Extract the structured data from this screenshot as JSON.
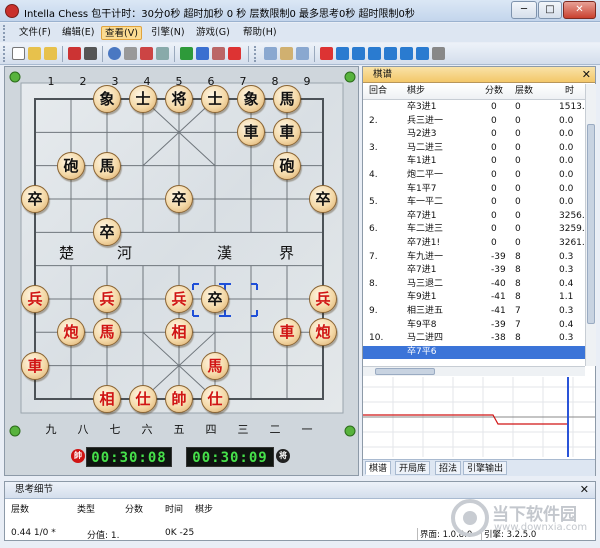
{
  "window": {
    "title": "Intella Chess 包干计时：30分0秒 超时加秒 0 秒 层数限制0 最多思考0秒 超时限制0秒",
    "min": "─",
    "max": "□",
    "close": "✕"
  },
  "menu": {
    "items": [
      "文件(F)",
      "编辑(E)",
      "查看(V)",
      "引擎(N)",
      "游戏(G)",
      "帮助(H)"
    ],
    "active": "查看(V)"
  },
  "board": {
    "top_numbers": [
      "1",
      "2",
      "3",
      "4",
      "5",
      "6",
      "7",
      "8",
      "9"
    ],
    "bottom_numbers": [
      "九",
      "八",
      "七",
      "六",
      "五",
      "四",
      "三",
      "二",
      "一"
    ],
    "river": [
      "楚",
      "河",
      "漢",
      "界"
    ],
    "pieces": [
      {
        "t": "象",
        "c": "black",
        "f": 2,
        "r": 0
      },
      {
        "t": "士",
        "c": "black",
        "f": 3,
        "r": 0
      },
      {
        "t": "将",
        "c": "black",
        "f": 4,
        "r": 0
      },
      {
        "t": "士",
        "c": "black",
        "f": 5,
        "r": 0
      },
      {
        "t": "象",
        "c": "black",
        "f": 6,
        "r": 0
      },
      {
        "t": "馬",
        "c": "black",
        "f": 7,
        "r": 0
      },
      {
        "t": "車",
        "c": "black",
        "f": 6,
        "r": 1
      },
      {
        "t": "車",
        "c": "black",
        "f": 7,
        "r": 1
      },
      {
        "t": "砲",
        "c": "black",
        "f": 1,
        "r": 2
      },
      {
        "t": "馬",
        "c": "black",
        "f": 2,
        "r": 2
      },
      {
        "t": "砲",
        "c": "black",
        "f": 7,
        "r": 2
      },
      {
        "t": "卒",
        "c": "black",
        "f": 0,
        "r": 3
      },
      {
        "t": "卒",
        "c": "black",
        "f": 4,
        "r": 3
      },
      {
        "t": "卒",
        "c": "black",
        "f": 8,
        "r": 3
      },
      {
        "t": "卒",
        "c": "black",
        "f": 2,
        "r": 4
      },
      {
        "t": "兵",
        "c": "red",
        "f": 0,
        "r": 6
      },
      {
        "t": "兵",
        "c": "red",
        "f": 2,
        "r": 6
      },
      {
        "t": "兵",
        "c": "red",
        "f": 4,
        "r": 6
      },
      {
        "t": "卒",
        "c": "black",
        "f": 5,
        "r": 6
      },
      {
        "t": "兵",
        "c": "red",
        "f": 8,
        "r": 6
      },
      {
        "t": "炮",
        "c": "red",
        "f": 1,
        "r": 7
      },
      {
        "t": "馬",
        "c": "red",
        "f": 2,
        "r": 7
      },
      {
        "t": "相",
        "c": "red",
        "f": 4,
        "r": 7
      },
      {
        "t": "車",
        "c": "red",
        "f": 7,
        "r": 7
      },
      {
        "t": "炮",
        "c": "red",
        "f": 8,
        "r": 7
      },
      {
        "t": "車",
        "c": "red",
        "f": 0,
        "r": 8
      },
      {
        "t": "馬",
        "c": "red",
        "f": 5,
        "r": 8
      },
      {
        "t": "相",
        "c": "red",
        "f": 2,
        "r": 9
      },
      {
        "t": "仕",
        "c": "red",
        "f": 3,
        "r": 9
      },
      {
        "t": "帥",
        "c": "red",
        "f": 4,
        "r": 9
      },
      {
        "t": "仕",
        "c": "red",
        "f": 5,
        "r": 9
      }
    ]
  },
  "clocks": {
    "red_label": "帥",
    "black_label": "将",
    "red_time": "00:30:08",
    "black_time": "00:30:09"
  },
  "record_panel": {
    "title": "棋谱",
    "headers": [
      "回合",
      "棋步",
      "分数",
      "层数",
      "时"
    ],
    "rows": [
      {
        "n": "",
        "m": "卒3进1",
        "s": "0",
        "d": "0",
        "t": "1513."
      },
      {
        "n": "2.",
        "m": "兵三进一",
        "s": "0",
        "d": "0",
        "t": "0.0"
      },
      {
        "n": "",
        "m": "马2进3",
        "s": "0",
        "d": "0",
        "t": "0.0"
      },
      {
        "n": "3.",
        "m": "马二进三",
        "s": "0",
        "d": "0",
        "t": "0.0"
      },
      {
        "n": "",
        "m": "车1进1",
        "s": "0",
        "d": "0",
        "t": "0.0"
      },
      {
        "n": "4.",
        "m": "炮二平一",
        "s": "0",
        "d": "0",
        "t": "0.0"
      },
      {
        "n": "",
        "m": "车1平7",
        "s": "0",
        "d": "0",
        "t": "0.0"
      },
      {
        "n": "5.",
        "m": "车一平二",
        "s": "0",
        "d": "0",
        "t": "0.0"
      },
      {
        "n": "",
        "m": "卒7进1",
        "s": "0",
        "d": "0",
        "t": "3256."
      },
      {
        "n": "6.",
        "m": "车二进三",
        "s": "0",
        "d": "0",
        "t": "3259."
      },
      {
        "n": "",
        "m": "卒7进1!",
        "s": "0",
        "d": "0",
        "t": "3261."
      },
      {
        "n": "7.",
        "m": "车九进一",
        "s": "-39",
        "d": "8",
        "t": "0.3"
      },
      {
        "n": "",
        "m": "卒7进1",
        "s": "-39",
        "d": "8",
        "t": "0.3"
      },
      {
        "n": "8.",
        "m": "马三退二",
        "s": "-40",
        "d": "8",
        "t": "0.4"
      },
      {
        "n": "",
        "m": "车9进1",
        "s": "-41",
        "d": "8",
        "t": "1.1"
      },
      {
        "n": "9.",
        "m": "相三进五",
        "s": "-41",
        "d": "7",
        "t": "0.3"
      },
      {
        "n": "",
        "m": "车9平8",
        "s": "-39",
        "d": "7",
        "t": "0.4"
      },
      {
        "n": "10.",
        "m": "马二进四",
        "s": "-38",
        "d": "8",
        "t": "0.3"
      },
      {
        "n": "",
        "m": "卒7平6",
        "s": "",
        "d": "",
        "t": ""
      }
    ],
    "tabs": [
      "棋谱",
      "开局库",
      "招法",
      "引擎输出"
    ],
    "active_tab": "棋谱"
  },
  "thinking_panel": {
    "title": "思考细节",
    "headers": [
      "层数",
      "类型",
      "分数",
      "时间",
      "棋步"
    ],
    "line": {
      "depth": "0.44 1/0 *",
      "type": "分值: 1.",
      "time": "0K -25"
    },
    "interface": "界面: 1.0.8.0",
    "engine": "引擎: 3.2.5.0"
  },
  "watermark": {
    "cn": "当下软件园",
    "en": "www.downxia.com"
  },
  "colors": {
    "red": "#d01414",
    "accent": "#f3c76a",
    "clock": "#46e04a"
  }
}
